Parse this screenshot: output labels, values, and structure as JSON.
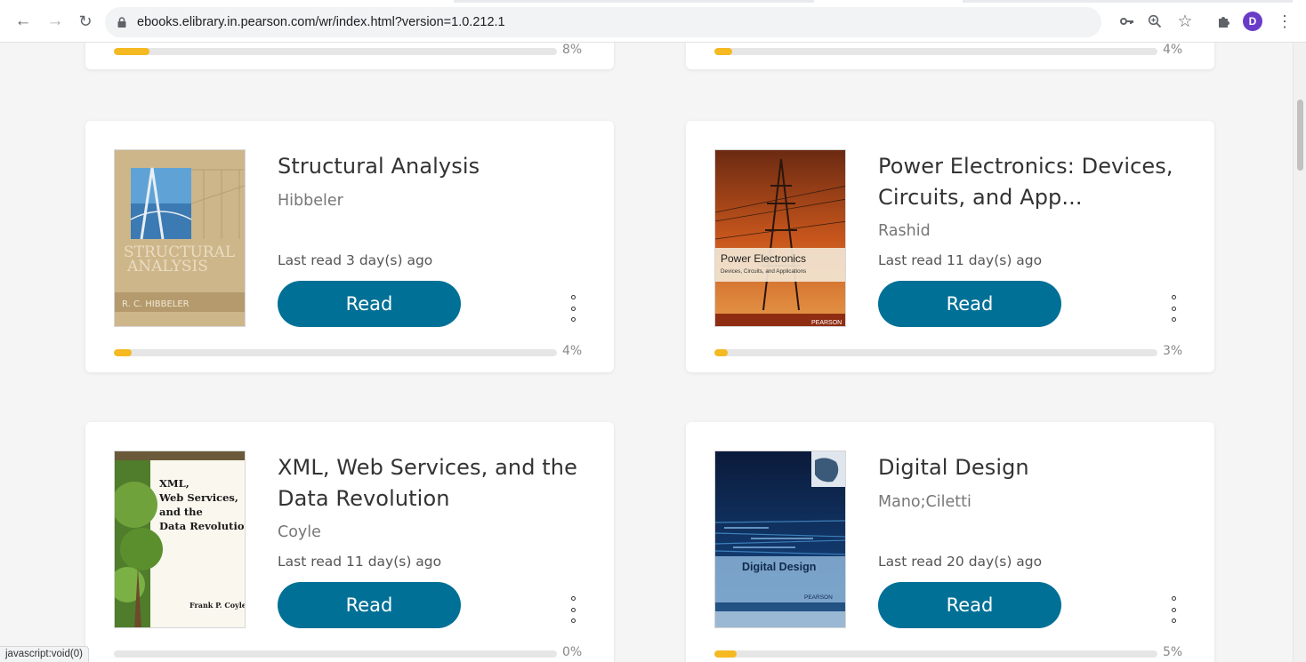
{
  "browser": {
    "url": "ebooks.elibrary.in.pearson.com/wr/index.html?version=1.0.212.1",
    "avatar_letter": "D",
    "status_text": "javascript:void(0)"
  },
  "colors": {
    "read_button": "#007096",
    "progress_fill": "#f5b921",
    "progress_track": "#e6e6e6"
  },
  "cards_top": [
    {
      "progress": 8,
      "percent_label": "8%"
    },
    {
      "progress": 4,
      "percent_label": "4%"
    }
  ],
  "books": [
    {
      "title": "Structural Analysis",
      "author": "Hibbeler",
      "last_read": "Last read 3 day(s) ago",
      "read_label": "Read",
      "progress": 4,
      "percent_label": "4%",
      "cover_text": [
        "STRUCTURAL",
        "ANALYSIS",
        "R. C. HIBBELER"
      ]
    },
    {
      "title": "Power Electronics: Devices, Circuits, and App...",
      "author": "Rashid",
      "last_read": "Last read 11 day(s) ago",
      "read_label": "Read",
      "progress": 3,
      "percent_label": "3%",
      "cover_text": [
        "Power Electronics",
        "Devices, Circuits, and Applications",
        "PEARSON"
      ]
    },
    {
      "title": "XML, Web Services, and the Data Revolution",
      "author": "Coyle",
      "last_read": "Last read 11 day(s) ago",
      "read_label": "Read",
      "progress": 0,
      "percent_label": "0%",
      "cover_text": [
        "XML,",
        "Web Services,",
        "and the",
        "Data Revolution",
        "Frank P. Coyle"
      ]
    },
    {
      "title": "Digital Design",
      "author": "Mano;Ciletti",
      "last_read": "Last read 20 day(s) ago",
      "read_label": "Read",
      "progress": 5,
      "percent_label": "5%",
      "cover_text": [
        "Digital Design",
        "PEARSON"
      ]
    }
  ]
}
